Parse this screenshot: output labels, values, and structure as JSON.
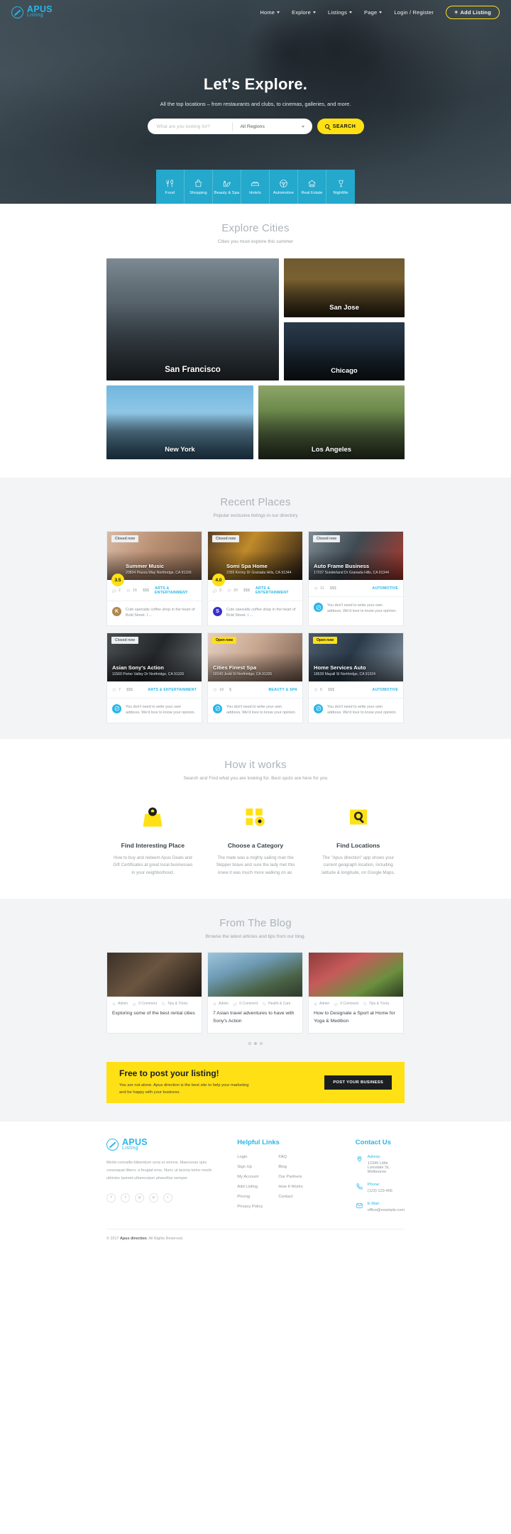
{
  "brand": {
    "name": "APUS",
    "sub": "Listing"
  },
  "nav": {
    "items": [
      {
        "label": "Home",
        "has_caret": true
      },
      {
        "label": "Explore",
        "has_caret": true
      },
      {
        "label": "Listings",
        "has_caret": true
      },
      {
        "label": "Page",
        "has_caret": true
      },
      {
        "label": "Login / Register",
        "has_caret": false
      }
    ],
    "add_listing": "Add Listing",
    "add_listing_plus": "+"
  },
  "hero": {
    "title": "Let's Explore.",
    "subtitle": "All the top locations – from restaurants and clubs, to cinemas, galleries, and more.",
    "search_placeholder": "What are you looking for?",
    "region_value": "All Regions",
    "search_button": "SEARCH"
  },
  "categories": [
    {
      "label": "Food",
      "icon": "food-icon"
    },
    {
      "label": "Shopping",
      "icon": "shopping-bag-icon"
    },
    {
      "label": "Beauty & Spa",
      "icon": "beauty-spa-icon"
    },
    {
      "label": "Hotels",
      "icon": "hotel-bed-icon"
    },
    {
      "label": "Automotive",
      "icon": "steering-wheel-icon"
    },
    {
      "label": "Real Estate",
      "icon": "house-icon"
    },
    {
      "label": "Nightlife",
      "icon": "wine-glass-icon"
    }
  ],
  "cities_section": {
    "title": "Explore Cities",
    "subtitle": "Cities you must explore this summer",
    "cities": [
      {
        "name": "San Francisco"
      },
      {
        "name": "San Jose"
      },
      {
        "name": "Chicago"
      },
      {
        "name": "New York"
      },
      {
        "name": "Los Angeles"
      }
    ]
  },
  "recent_section": {
    "title": "Recent Places",
    "subtitle": "Popular exclusive listings in our directory",
    "listings": [
      {
        "badge": "Closed now",
        "badge_type": "closed",
        "rating": "3.5",
        "name": "Summer Music",
        "address": "20834 Piazza Way Northridge, CA 91326",
        "comments": "2",
        "likes": "16",
        "price": "$$$",
        "category": "ARTS & ENTERTAINMENT",
        "review": "Cute specialty coffee shop in the heart of Bold Street. I ...",
        "avatar_letter": "K",
        "avatar_color": "#b2884f"
      },
      {
        "badge": "Closed now",
        "badge_type": "closed",
        "rating": "4.0",
        "name": "Somi Spa Home",
        "address": "2355 Kenny Dr Granada Hills, CA 91344",
        "comments": "3",
        "likes": "20",
        "price": "$$$",
        "category": "ARTS & ENTERTAINMENT",
        "review": "Cute specialty coffee shop in the heart of Bold Street. I ...",
        "avatar_letter": "S",
        "avatar_color": "#3b2fc9"
      },
      {
        "badge": "Closed now",
        "badge_type": "closed",
        "rating": "",
        "name": "Auto Frame Business",
        "address": "17237 Sunderland Dr Granada Hills, CA 91344",
        "comments": "",
        "likes": "11",
        "price": "$$$",
        "category": "AUTOMOTIVE",
        "review": "You don't need to write your own address. We'd love to know your opinion.",
        "avatar_letter": "",
        "avatar_color": "#29b6e8"
      },
      {
        "badge": "Closed now",
        "badge_type": "closed",
        "rating": "",
        "name": "Asian Sony's Action",
        "address": "11560 Porter Valley Dr Northridge, CA 91326",
        "comments": "",
        "likes": "7",
        "price": "$$$",
        "category": "ARTS & ENTERTAINMENT",
        "review": "You don't need to write your own address. We'd love to know your opinion.",
        "avatar_letter": "",
        "avatar_color": "#29b6e8"
      },
      {
        "badge": "Open now",
        "badge_type": "open",
        "rating": "",
        "name": "Cities Finest Spa",
        "address": "18143 Jedd St Northridge, CA 91325",
        "comments": "",
        "likes": "18",
        "price": "$",
        "category": "BEAUTY & SPA",
        "review": "You don't need to write your own address. We'd love to know your opinion.",
        "avatar_letter": "",
        "avatar_color": "#29b6e8"
      },
      {
        "badge": "Open now",
        "badge_type": "open",
        "rating": "",
        "name": "Home Services Auto",
        "address": "18539 Mayall St Northridge, CA 91324",
        "comments": "",
        "likes": "6",
        "price": "$$$",
        "category": "AUTOMOTIVE",
        "review": "You don't need to write your own address. We'd love to know your opinion.",
        "avatar_letter": "",
        "avatar_color": "#29b6e8"
      }
    ]
  },
  "how_section": {
    "title": "How it works",
    "subtitle": "Search and Find what you are looking for. Best spots are here for you",
    "steps": [
      {
        "icon": "map-pin-folder-icon",
        "title": "Find Interesting Place",
        "desc": "How to buy and redeem Apus Deals and Gift Certificates at great local businesses in your neighborhood."
      },
      {
        "icon": "category-gear-icon",
        "title": "Choose a Category",
        "desc": "The mate was a mighty sailing man the Skipper brave and sure the lady met this knew it was much more walking on air."
      },
      {
        "icon": "search-location-icon",
        "title": "Find Locations",
        "desc": "The \"Apus direction\" app shows your current geograph location, including latitude & longitude, on Google Maps."
      }
    ]
  },
  "blog_section": {
    "title": "From The Blog",
    "subtitle": "Browse the latest articles and tips from our blog.",
    "posts": [
      {
        "author": "Admin",
        "comments": "0 Comment",
        "tag": "Tips & Tricks",
        "title": "Exploring some of the best rental cities"
      },
      {
        "author": "Admin",
        "comments": "0 Comment",
        "tag": "Health & Care",
        "title": "7 Asian travel adventures to have with Sony's Action"
      },
      {
        "author": "Admin",
        "comments": "0 Comment",
        "tag": "Tips & Tricks",
        "title": "How to Designate a Sport at Home for Yoga & Medition"
      }
    ],
    "dots": [
      false,
      true,
      false
    ]
  },
  "cta": {
    "title": "Free to post your listing!",
    "desc_line1": "You are not alone. Apus direction is the best site to help your marketing",
    "desc_line2": "and be happy with your business.",
    "button": "POST YOUR BUSINESS"
  },
  "footer": {
    "about": "Morbi convallis bibendum urna ut viverra. Maecenas quis consequat libero, a feugiat eros. Nunc ut lacinia tortor morbi ultricies laoreet ullamcorper phasellus semper.",
    "social": [
      "facebook-icon",
      "twitter-icon",
      "google-plus-icon",
      "pinterest-icon",
      "instagram-icon"
    ],
    "social_glyphs": [
      "f",
      "t",
      "g",
      "p",
      "i"
    ],
    "helpful_title": "Helpful Links",
    "helpful_col1": [
      "Login",
      "Sign Up",
      "My Account",
      "Add Listing",
      "Pricing",
      "Privacy Policy"
    ],
    "helpful_col2": [
      "FAQ",
      "Blog",
      "Our Partners",
      "How It Works",
      "Contact"
    ],
    "contact_title": "Contact Us",
    "contact": [
      {
        "icon": "map-marker-icon",
        "label": "Adress:",
        "value": "12345 Little Lonsdale St, Melbourne"
      },
      {
        "icon": "phone-icon",
        "label": "Phone:",
        "value": "(123) 123-456"
      },
      {
        "icon": "mail-icon",
        "label": "E-Mail:",
        "value": "office@example.com"
      }
    ],
    "copyright_pre": "© 2017 ",
    "copyright_brand": "Apus direction",
    "copyright_post": ", All Rights Reserved."
  },
  "colors": {
    "accent": "#29b6e8",
    "yellow": "#ffe014",
    "cat_bar": "#24a8cc",
    "dark": "#1c1f21"
  }
}
